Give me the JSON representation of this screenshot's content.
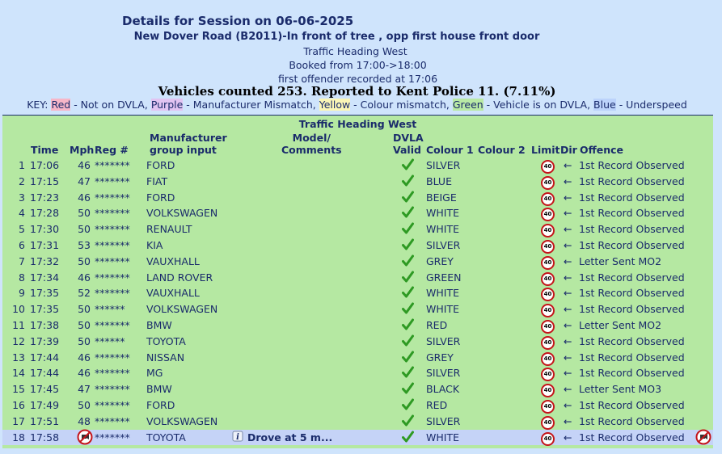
{
  "header": {
    "title": "Details for Session on 06-06-2025",
    "location": "New Dover Road (B2011)-In front of tree , opp first house front door",
    "heading": "Traffic Heading West",
    "booked": "Booked from 17:00->18:00",
    "first_offender": "first offender recorded at 17:06",
    "counted": "Vehicles counted 253.  Reported to Kent Police 11. (7.11%)"
  },
  "key": {
    "prefix": "KEY: ",
    "red": "Red",
    "red_desc": " - Not on DVLA, ",
    "purple": "Purple",
    "purple_desc": " - Manufacturer Mismatch, ",
    "yellow": "Yellow",
    "yellow_desc": " - Colour mismatch, ",
    "green": "Green",
    "green_desc": " - Vehicle is on DVLA, ",
    "blue": "Blue",
    "blue_desc": " - Underspeed"
  },
  "table": {
    "caption": "Traffic Heading West",
    "headers": {
      "time": "Time",
      "mph": "Mph",
      "reg": "Reg #",
      "manufacturer_1": "Manufacturer",
      "manufacturer_2": "group input",
      "model_1": "Model/",
      "model_2": "Comments",
      "dvla_1": "DVLA",
      "dvla_2": "Valid",
      "colour1": "Colour 1",
      "colour2": "Colour 2",
      "limit": "Limit",
      "dir": "Dir",
      "offence": "Offence"
    },
    "limit_value": "40",
    "rows": [
      {
        "num": "1",
        "time": "17:06",
        "mph": "46",
        "reg": "*******",
        "manu": "FORD",
        "colour1": "SILVER",
        "dir": "←",
        "offence": "1st Record Observed"
      },
      {
        "num": "2",
        "time": "17:15",
        "mph": "47",
        "reg": "*******",
        "manu": "FIAT",
        "colour1": "BLUE",
        "dir": "←",
        "offence": "1st Record Observed"
      },
      {
        "num": "3",
        "time": "17:23",
        "mph": "46",
        "reg": "*******",
        "manu": "FORD",
        "colour1": "BEIGE",
        "dir": "←",
        "offence": "1st Record Observed"
      },
      {
        "num": "4",
        "time": "17:28",
        "mph": "50",
        "reg": "*******",
        "manu": "VOLKSWAGEN",
        "colour1": "WHITE",
        "dir": "←",
        "offence": "1st Record Observed"
      },
      {
        "num": "5",
        "time": "17:30",
        "mph": "50",
        "reg": "*******",
        "manu": "RENAULT",
        "colour1": "WHITE",
        "dir": "←",
        "offence": "1st Record Observed"
      },
      {
        "num": "6",
        "time": "17:31",
        "mph": "53",
        "reg": "*******",
        "manu": "KIA",
        "colour1": "SILVER",
        "dir": "←",
        "offence": "1st Record Observed"
      },
      {
        "num": "7",
        "time": "17:32",
        "mph": "50",
        "reg": "*******",
        "manu": "VAUXHALL",
        "colour1": "GREY",
        "dir": "←",
        "offence": "Letter Sent MO2"
      },
      {
        "num": "8",
        "time": "17:34",
        "mph": "46",
        "reg": "*******",
        "manu": "LAND ROVER",
        "colour1": "GREEN",
        "dir": "←",
        "offence": "1st Record Observed"
      },
      {
        "num": "9",
        "time": "17:35",
        "mph": "52",
        "reg": "*******",
        "manu": "VAUXHALL",
        "colour1": "WHITE",
        "dir": "←",
        "offence": "1st Record Observed"
      },
      {
        "num": "10",
        "time": "17:35",
        "mph": "50",
        "reg": "******",
        "manu": "VOLKSWAGEN",
        "colour1": "WHITE",
        "dir": "←",
        "offence": "1st Record Observed"
      },
      {
        "num": "11",
        "time": "17:38",
        "mph": "50",
        "reg": "*******",
        "manu": "BMW",
        "colour1": "RED",
        "dir": "←",
        "offence": "Letter Sent MO2"
      },
      {
        "num": "12",
        "time": "17:39",
        "mph": "50",
        "reg": "******",
        "manu": "TOYOTA",
        "colour1": "SILVER",
        "dir": "←",
        "offence": "1st Record Observed"
      },
      {
        "num": "13",
        "time": "17:44",
        "mph": "46",
        "reg": "*******",
        "manu": "NISSAN",
        "colour1": "GREY",
        "dir": "←",
        "offence": "1st Record Observed"
      },
      {
        "num": "14",
        "time": "17:44",
        "mph": "46",
        "reg": "*******",
        "manu": "MG",
        "colour1": "SILVER",
        "dir": "←",
        "offence": "1st Record Observed"
      },
      {
        "num": "15",
        "time": "17:45",
        "mph": "47",
        "reg": "*******",
        "manu": "BMW",
        "colour1": "BLACK",
        "dir": "←",
        "offence": "Letter Sent MO3"
      },
      {
        "num": "16",
        "time": "17:49",
        "mph": "50",
        "reg": "*******",
        "manu": "FORD",
        "colour1": "RED",
        "dir": "←",
        "offence": "1st Record Observed"
      },
      {
        "num": "17",
        "time": "17:51",
        "mph": "48",
        "reg": "*******",
        "manu": "VOLKSWAGEN",
        "colour1": "SILVER",
        "dir": "←",
        "offence": "1st Record Observed"
      },
      {
        "num": "18",
        "time": "17:58",
        "mph": "",
        "reg": "*******",
        "manu": "TOYOTA",
        "colour1": "WHITE",
        "dir": "←",
        "offence": "1st Record Observed",
        "note": "Drove at 5 m...",
        "selected": true
      }
    ]
  },
  "colors": {
    "page_bg": "#cfe4fc",
    "panel_bg": "#b5e8a2",
    "selected_row_bg": "#c5d3f7",
    "text": "#1a2b6b",
    "limit_ring": "#c4151a"
  },
  "icons": {
    "valid": "check-icon",
    "limit": "speed-limit-40-icon",
    "direction": "left-arrow",
    "info": "info-icon",
    "camera_cancel": "no-camera-icon"
  }
}
